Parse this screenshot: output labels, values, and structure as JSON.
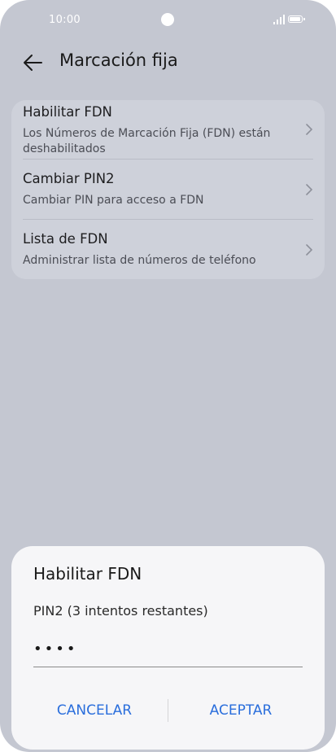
{
  "status_bar": {
    "time": "10:00"
  },
  "header": {
    "title": "Marcación fija"
  },
  "settings": {
    "items": [
      {
        "title": "Habilitar FDN",
        "subtitle": "Los Números de Marcación Fija (FDN) están deshabilitados"
      },
      {
        "title": "Cambiar PIN2",
        "subtitle": "Cambiar PIN para acceso a FDN"
      },
      {
        "title": "Lista de FDN",
        "subtitle": "Administrar lista de números de teléfono"
      }
    ]
  },
  "dialog": {
    "title": "Habilitar FDN",
    "field_label": "PIN2 (3 intentos restantes)",
    "field_value": "••••",
    "cancel_label": "CANCELAR",
    "confirm_label": "ACEPTAR"
  },
  "colors": {
    "background": "#c4c7d1",
    "card": "#ced1da",
    "dialog": "#f6f6f8",
    "accent": "#2a6edc"
  },
  "icons": [
    "back-arrow-icon",
    "chevron-right-icon",
    "signal-icon",
    "battery-icon"
  ]
}
